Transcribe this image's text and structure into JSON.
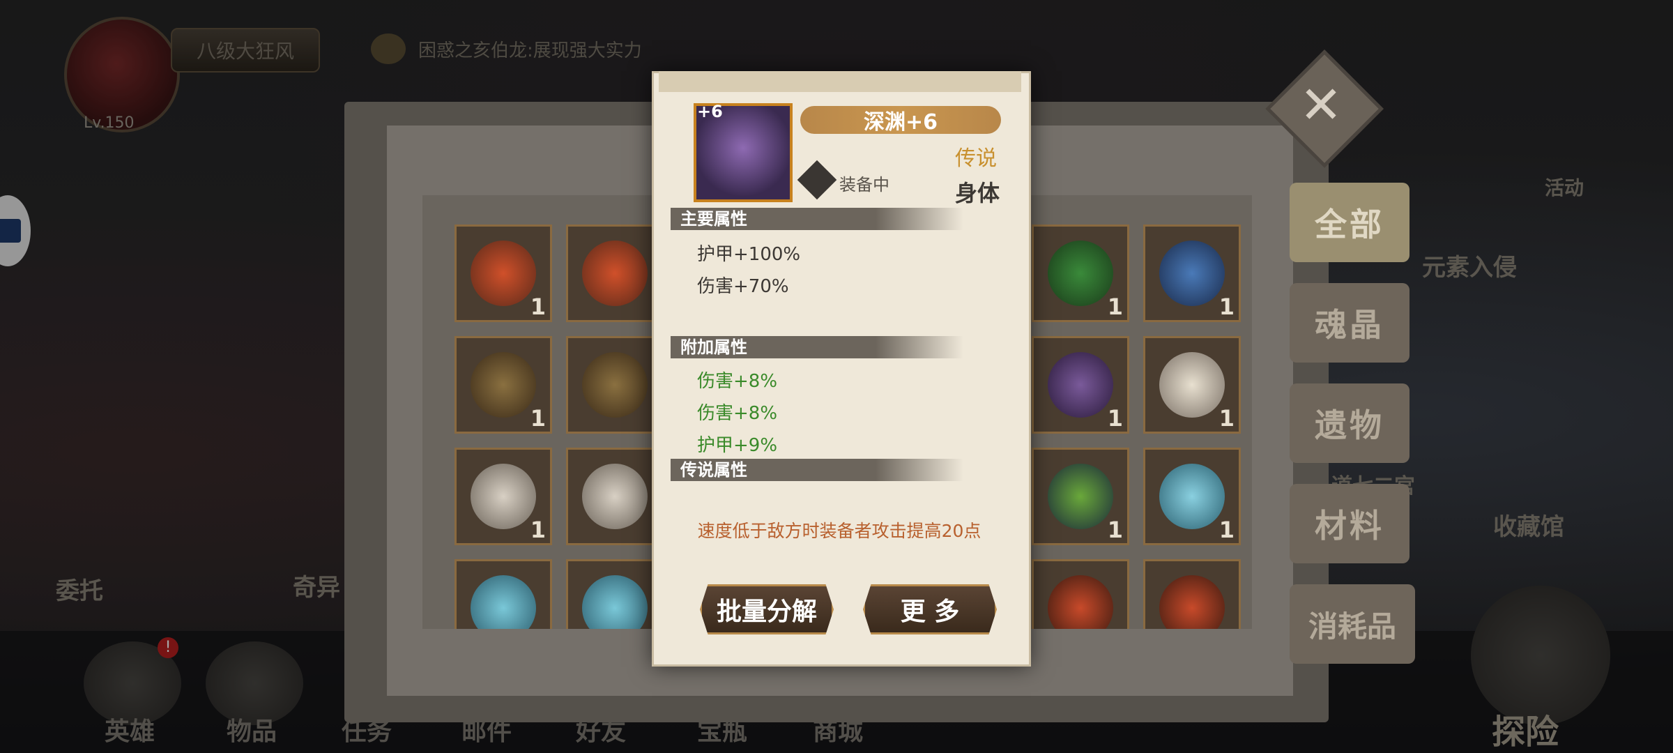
{
  "profile": {
    "title": "八级大狂风",
    "level": "Lv.150"
  },
  "chat": {
    "message": "困惑之亥伯龙:展现强大实力"
  },
  "background_labels": {
    "commission": "委托",
    "strange": "奇异",
    "activity": "活动",
    "element_invasion": "元素入侵",
    "palace": "道七二宫",
    "collection": "收藏馆",
    "explore": "探险"
  },
  "bottom_nav": [
    {
      "label": "英雄",
      "badge": "!"
    },
    {
      "label": "物品"
    },
    {
      "label": "任务"
    },
    {
      "label": "邮件"
    },
    {
      "label": "好友"
    },
    {
      "label": "宝瓶"
    },
    {
      "label": "商城"
    }
  ],
  "categories": [
    {
      "label": "全部",
      "active": true
    },
    {
      "label": "魂晶"
    },
    {
      "label": "遗物"
    },
    {
      "label": "材料"
    },
    {
      "label": "消耗品"
    }
  ],
  "inventory_quantities": [
    "1",
    "1",
    "1",
    "1",
    "1",
    "1",
    "1",
    "1"
  ],
  "item": {
    "plus": "+6",
    "name": "深渊+6",
    "rarity": "传说",
    "slot": "身体",
    "status": "装备中",
    "main_header": "主要属性",
    "main_attrs": [
      "护甲+100%",
      "伤害+70%"
    ],
    "extra_header": "附加属性",
    "extra_attrs": [
      "伤害+8%",
      "伤害+8%",
      "护甲+9%"
    ],
    "legend_header": "传说属性",
    "legend_desc": "速度低于敌方时装备者攻击提高20点"
  },
  "actions": {
    "batch_dismantle": "批量分解",
    "more": "更 多"
  },
  "colors": {
    "rarity_legend": "#c8902e",
    "extra_attr": "#3a8a2a",
    "legend_text": "#b8602e",
    "name_plate": "#c9964f"
  }
}
